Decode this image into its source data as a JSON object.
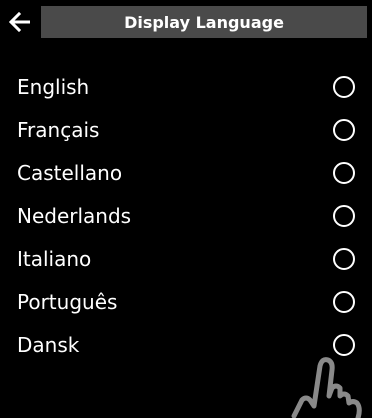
{
  "header": {
    "title": "Display Language",
    "back_icon": "arrow-left-icon"
  },
  "languages": [
    {
      "label": "English",
      "selected": false
    },
    {
      "label": "Français",
      "selected": false
    },
    {
      "label": "Castellano",
      "selected": false
    },
    {
      "label": "Nederlands",
      "selected": false
    },
    {
      "label": "Italiano",
      "selected": false
    },
    {
      "label": "Português",
      "selected": false
    },
    {
      "label": "Dansk",
      "selected": false
    }
  ],
  "colors": {
    "background": "#000000",
    "title_bar": "#4a4a4a",
    "text": "#ffffff",
    "hand_outline": "#8a8a8a"
  },
  "overlay": {
    "icon": "pointing-hand-icon"
  }
}
